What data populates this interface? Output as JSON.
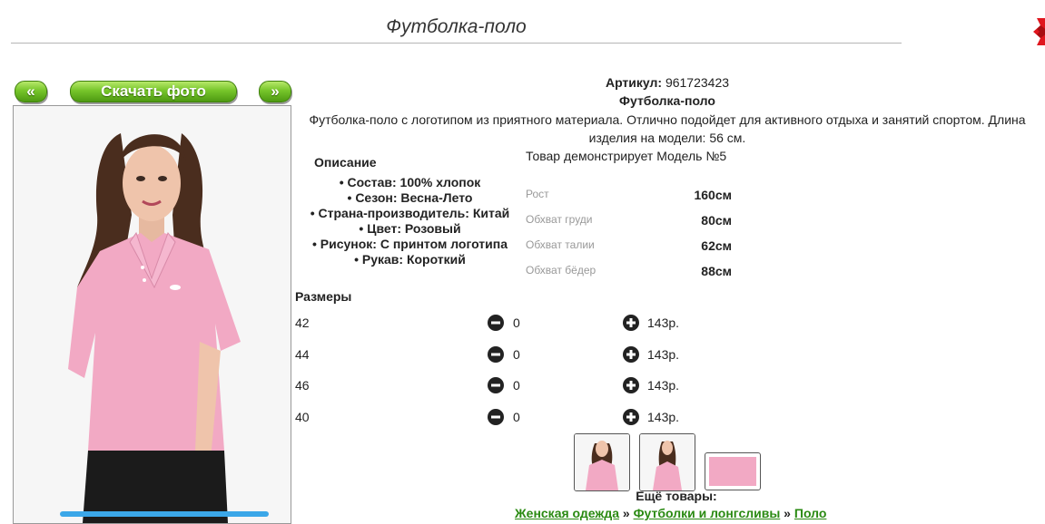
{
  "title": "Футболка-поло",
  "nav": {
    "prev": "«",
    "download": "Скачать фото",
    "next": "»"
  },
  "sku": {
    "label": "Артикул:",
    "value": "961723423"
  },
  "product_name": "Футболка-поло",
  "description": "Футболка-поло с логотипом из приятного материала. Отлично подойдет для активного отдыха и занятий спортом. Длина изделия на модели: 56 см.",
  "details": {
    "heading": "Описание",
    "items": [
      "• Состав: 100% хлопок",
      "• Сезон: Весна-Лето",
      "• Страна-производитель: Китай",
      "• Цвет: Розовый",
      "• Рисунок: С принтом логотипа",
      "• Рукав: Короткий"
    ]
  },
  "model": {
    "caption": "Товар демонстрирует Модель №5",
    "rows": [
      {
        "label": "Рост",
        "value": "160см"
      },
      {
        "label": "Обхват груди",
        "value": "80см"
      },
      {
        "label": "Обхват талии",
        "value": "62см"
      },
      {
        "label": "Обхват бёдер",
        "value": "88см"
      }
    ]
  },
  "sizes": {
    "heading": "Размеры",
    "rows": [
      {
        "size": "42",
        "qty": "0",
        "price": "143р."
      },
      {
        "size": "44",
        "qty": "0",
        "price": "143р."
      },
      {
        "size": "46",
        "qty": "0",
        "price": "143р."
      },
      {
        "size": "40",
        "qty": "0",
        "price": "143р."
      }
    ]
  },
  "more": {
    "title": "Ещё товары:",
    "crumbs": [
      "Женская одежда",
      "Футболки и лонгсливы",
      "Поло"
    ],
    "separator": " » "
  },
  "icons": {
    "minus": "minus-circle-icon",
    "plus": "plus-circle-icon",
    "close": "close-icon"
  },
  "colors": {
    "accent_green": "#76c52a",
    "shirt_pink": "#f2a9c4",
    "link_green": "#2a8a12",
    "close_red": "#e0161e"
  }
}
